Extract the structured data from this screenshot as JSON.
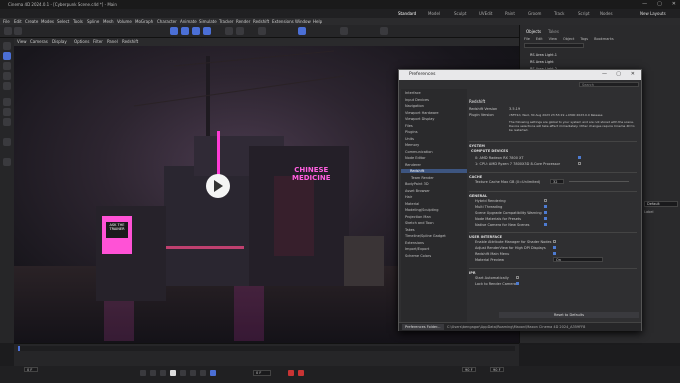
{
  "window": {
    "title": "Cinema 4D 2024.0.1 - [Cyberpunk Scene.c4d *] - Main",
    "tab": "Cyberpunk Scene.c4d",
    "controls": [
      "—",
      "▢",
      "✕"
    ]
  },
  "menubar": [
    "File",
    "Edit",
    "Create",
    "Modes",
    "Select",
    "Tools",
    "Spline",
    "Mesh",
    "Volume",
    "MoGraph",
    "Character",
    "Animate",
    "Simulate",
    "Tracker",
    "Render",
    "Redshift",
    "Extensions",
    "Window",
    "Help"
  ],
  "layouts": {
    "items": [
      "Standard",
      "Model",
      "Sculpt",
      "UVEdit",
      "Paint",
      "Groom",
      "Track",
      "Script",
      "Nodes"
    ],
    "new_layouts": "New Layouts"
  },
  "viewport_menu": [
    "View",
    "Cameras",
    "Display",
    "Options",
    "Filter",
    "Panel",
    "Redshift"
  ],
  "viewport": {
    "sign_line1": "CHINESE",
    "sign_line2": "MEDICINE",
    "kiosk_line1": "ASK THE",
    "kiosk_line2": "TRAINER"
  },
  "object_manager": {
    "tabs": [
      "Objects",
      "Takes"
    ],
    "menu": [
      "File",
      "Edit",
      "View",
      "Object",
      "Tags",
      "Bookmarks"
    ],
    "items": [
      "RS Area Light.1",
      "RS Area Light",
      "RS Area Light.2"
    ],
    "attr_value": "Default",
    "attr_label": "Label"
  },
  "preferences": {
    "title": "Preferences",
    "search_placeholder": "Search",
    "tree": [
      "Interface",
      "Input Devices",
      "Navigation",
      "Viewport Hardware",
      "Viewport Display",
      "Files",
      "Plugins",
      "Units",
      "Memory",
      "Communication",
      "Node Editor",
      "Renderer",
      "Redshift",
      "Team Render",
      "BodyPaint 3D",
      "Asset Browser",
      "Hair",
      "Material",
      "Modeling/Sculpting",
      "Projection Man",
      "Sketch and Toon",
      "Takes",
      "Timeline/Spline Gadget",
      "Extensions",
      "Import/Export",
      "Scheme Colors"
    ],
    "selected": "Redshift",
    "header": "Redshift",
    "version_label": "Redshift Version",
    "version_value": "3.5.19",
    "plugin_label": "Plugin Version",
    "plugin_value": "c5ff72d, Wed, 30 Aug 2023 23:53:19 +0300 2023.0.0 Release",
    "note": "The following settings are global to your system and are not stored with the scene. Device selections will take effect immediately. Other changes require Cinema 4D to be restarted.",
    "sections": {
      "system": "SYSTEM",
      "compute_devices": "COMPUTE DEVICES",
      "cache": "CACHE",
      "general": "GENERAL",
      "ui": "USER INTERFACE",
      "ipr": "IPR"
    },
    "devices": [
      "0: AMD Radeon RX 7800 XT",
      "1: CPU: AMD Ryzen 7 7800X3D 8-Core Processor"
    ],
    "cache_label": "Texture Cache Max GB (0=Unlimited)",
    "cache_value": "32",
    "general": [
      "Hybrid Rendering",
      "Multi Threading",
      "Scene Upgrade Compatibility Warning",
      "Node Materials for Presets",
      "Native Camera for New Scenes"
    ],
    "ui": [
      "Enable Attribute Manager for Shader Nodes",
      "Adjust RenderView for High DPI Displays",
      "Redshift Main Menu",
      "Material Preview"
    ],
    "material_preview_value": "On",
    "ipr": [
      "Start Automatically",
      "Lock to Render Camera"
    ],
    "reset": "Reset to Defaults",
    "footer_button": "Preferences Folder...",
    "footer_path": "C:\\Users\\bengagar\\AppData\\Roaming\\Maxon\\Maxon Cinema 4D 2024_A359FF8"
  },
  "timeline": {
    "current_frame": "0 F",
    "start": "0 F",
    "end": "90 F",
    "end2": "90 F"
  }
}
